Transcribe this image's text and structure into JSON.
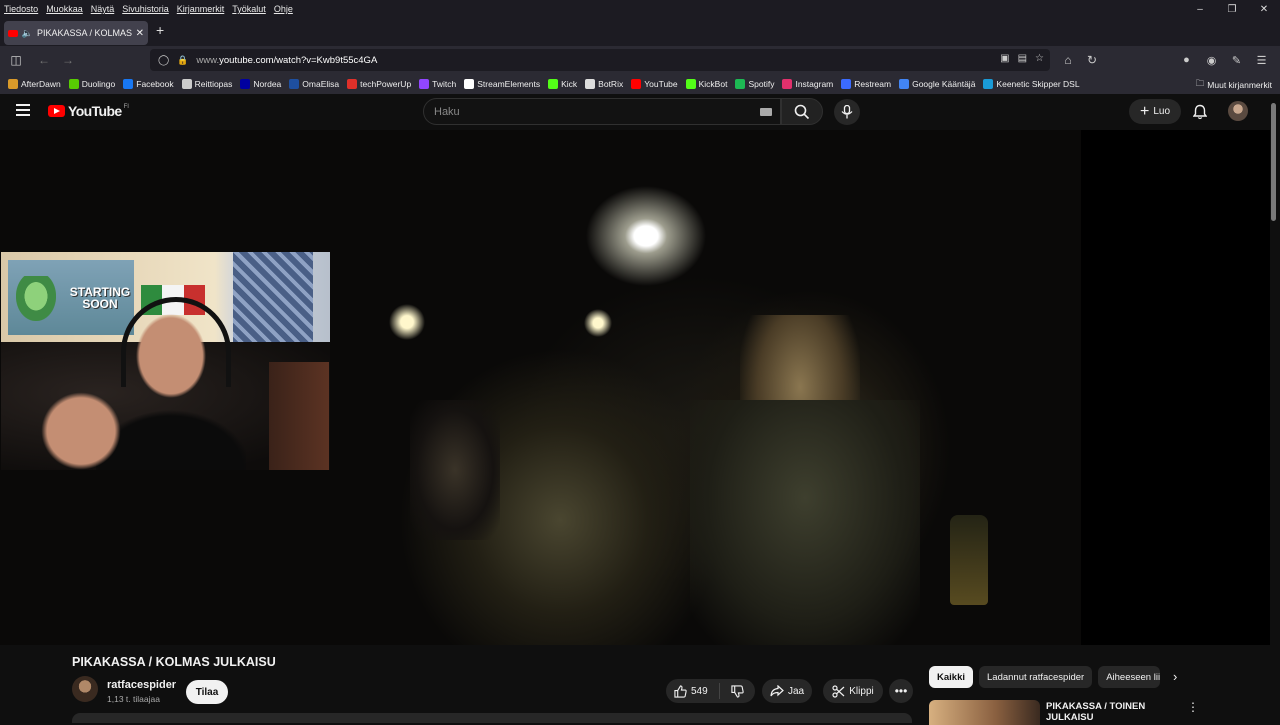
{
  "menubar": {
    "items": [
      "Tiedosto",
      "Muokkaa",
      "Näytä",
      "Sivuhistoria",
      "Kirjanmerkit",
      "Työkalut",
      "Ohje"
    ]
  },
  "tab": {
    "title": "PIKAKASSA / KOLMAS JULKAISU"
  },
  "url": {
    "prefix": "www.",
    "main": "youtube.com/watch?v=Kwb9t55c4GA"
  },
  "bookmarks": [
    {
      "label": "AfterDawn",
      "color": "#d99a2a"
    },
    {
      "label": "Duolingo",
      "color": "#58cc02"
    },
    {
      "label": "Facebook",
      "color": "#1877f2"
    },
    {
      "label": "Reittiopas",
      "color": "#cccccc"
    },
    {
      "label": "Nordea",
      "color": "#0000a0"
    },
    {
      "label": "OmaElisa",
      "color": "#1e4fa0"
    },
    {
      "label": "techPowerUp",
      "color": "#e0302a"
    },
    {
      "label": "Twitch",
      "color": "#9146ff"
    },
    {
      "label": "StreamElements",
      "color": "#ffffff"
    },
    {
      "label": "Kick",
      "color": "#53fc18"
    },
    {
      "label": "BotRix",
      "color": "#dddddd"
    },
    {
      "label": "YouTube",
      "color": "#ff0000"
    },
    {
      "label": "KickBot",
      "color": "#53fc18"
    },
    {
      "label": "Spotify",
      "color": "#1db954"
    },
    {
      "label": "Instagram",
      "color": "#e1306c"
    },
    {
      "label": "Restream",
      "color": "#3b6bff"
    },
    {
      "label": "Google Kääntäjä",
      "color": "#4285f4"
    },
    {
      "label": "Keenetic Skipper DSL",
      "color": "#1a9ad6"
    }
  ],
  "bookmarks_other": "Muut kirjanmerkit",
  "youtube": {
    "logo_text": "YouTube",
    "country": "FI",
    "search_placeholder": "Haku",
    "create_label": "Luo"
  },
  "webcam": {
    "poster_text": "STARTING SOON"
  },
  "video": {
    "title": "PIKAKASSA / KOLMAS JULKAISU",
    "channel": "ratfacespider",
    "subscribers": "1,13 t. tilaajaa",
    "subscribe_label": "Tilaa",
    "likes": "549",
    "share_label": "Jaa",
    "clip_label": "Klippi"
  },
  "chips": [
    "Kaikki",
    "Ladannut ratfacespider",
    "Aiheeseen liittyvät"
  ],
  "recommendation": {
    "title": "PIKAKASSA / TOINEN JULKAISU"
  },
  "colors": {
    "accent": "#ff0000",
    "background": "#0f0f0f"
  }
}
